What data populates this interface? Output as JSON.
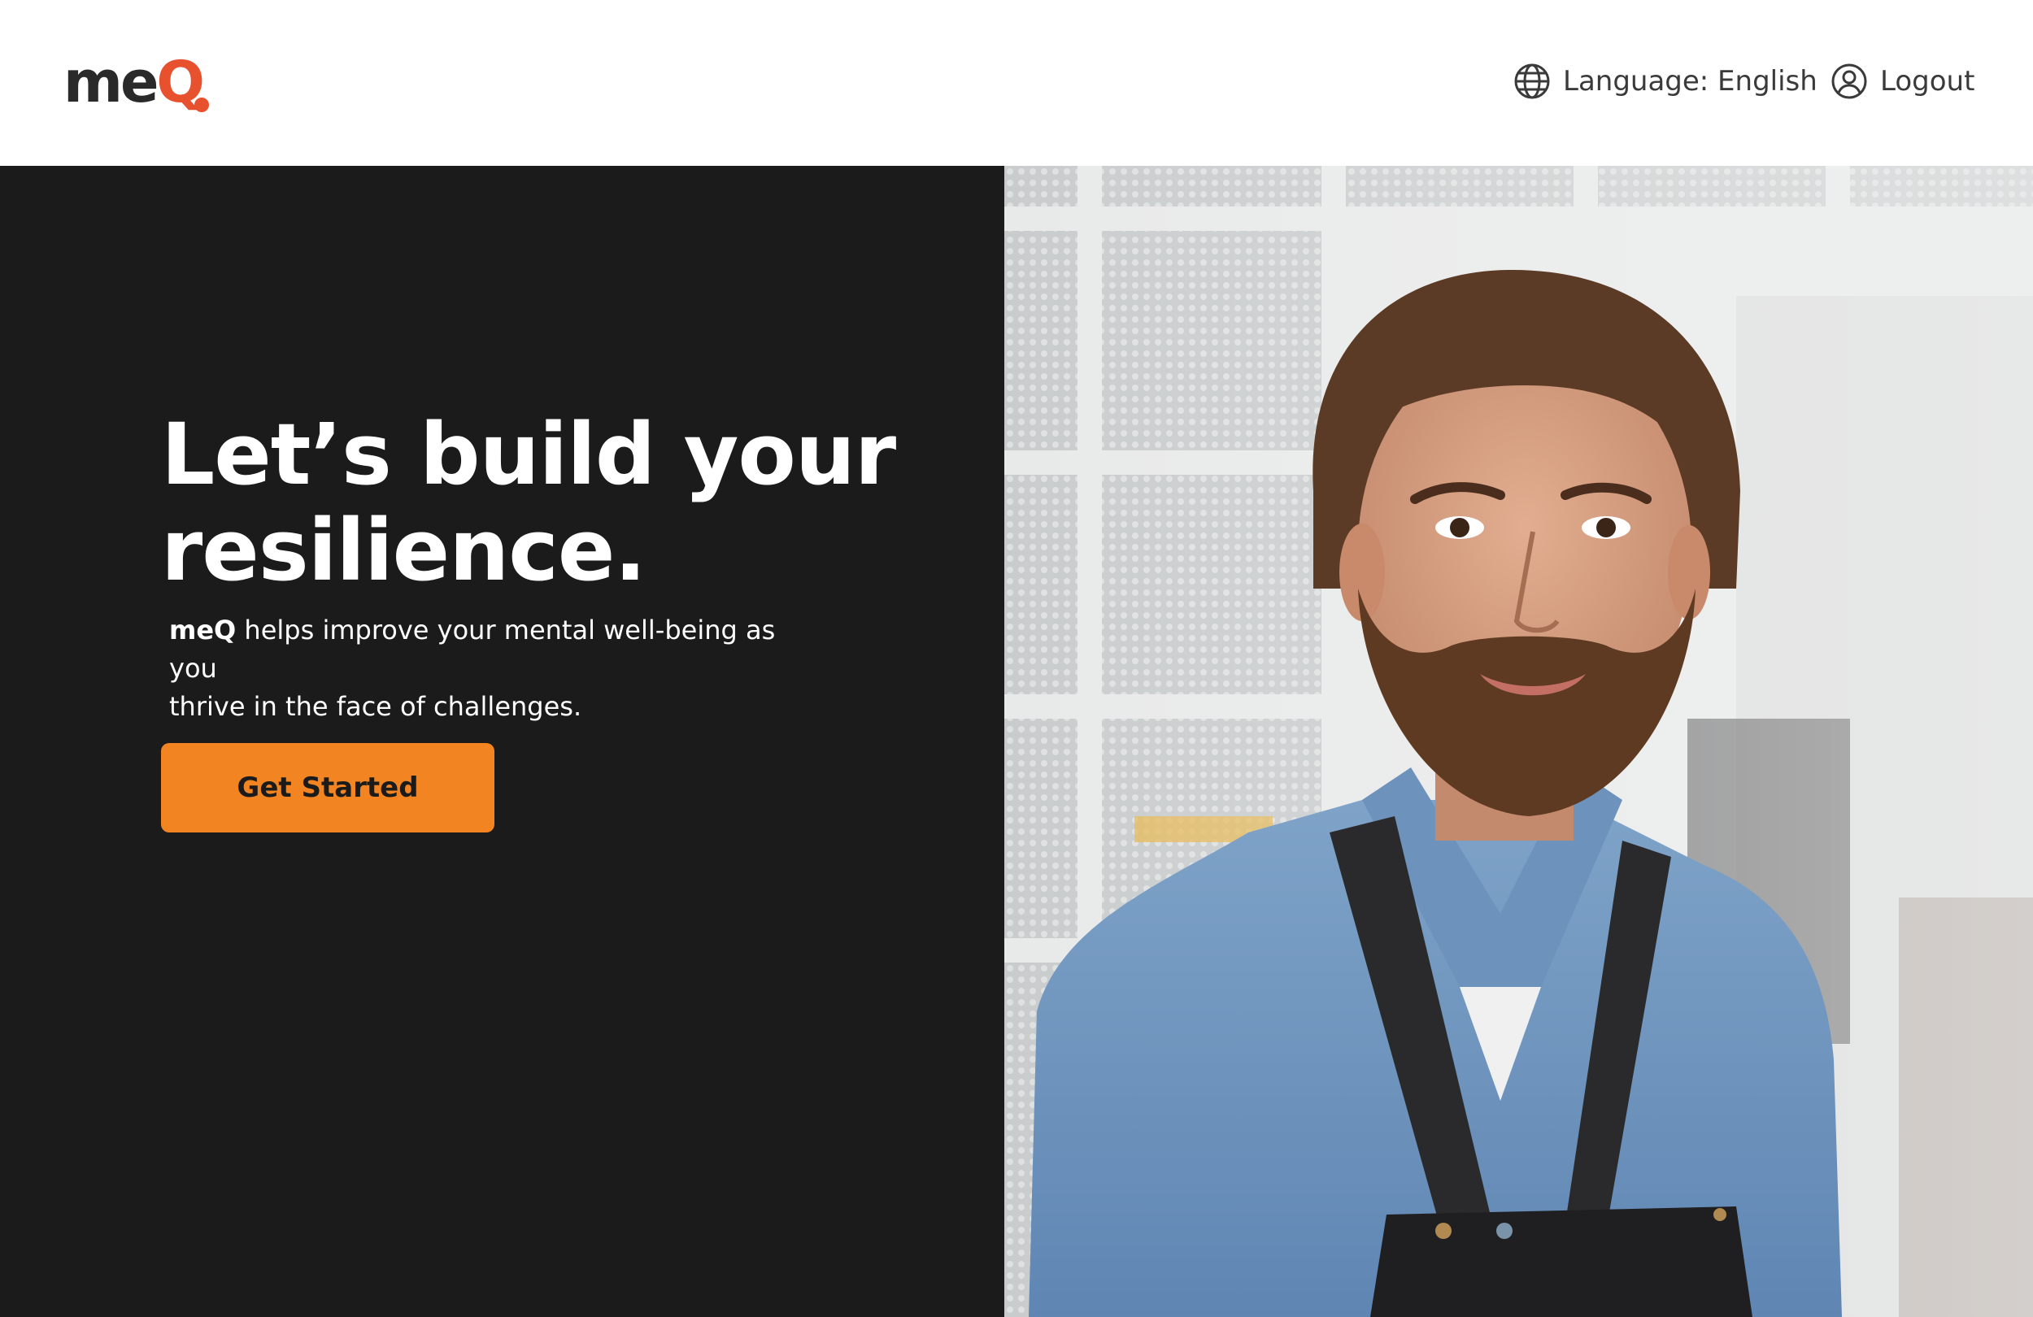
{
  "brand": {
    "logo_main": "me",
    "logo_q": "Q",
    "colors": {
      "accent": "#e8512d",
      "button": "#f28521",
      "dark_panel": "#1b1b1c"
    }
  },
  "nav": {
    "language_label": "Language: English",
    "language_icon": "globe-icon",
    "logout_label": "Logout",
    "logout_icon": "user-circle-icon"
  },
  "hero": {
    "headline_line1": "Let’s build your",
    "headline_line2": "resilience.",
    "sub_brand": "meQ",
    "sub_text_line1": " helps improve your mental well-being as you",
    "sub_text_line2": "thrive in the face of challenges.",
    "cta_label": "Get Started"
  }
}
